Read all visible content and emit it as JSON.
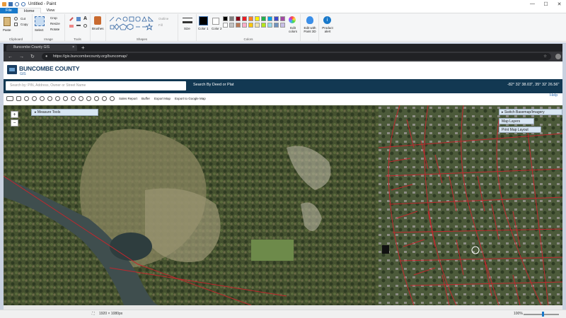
{
  "window": {
    "title": "Untitled - Paint",
    "controls": [
      "—",
      "☐",
      "✕"
    ]
  },
  "ribbon_tabs": [
    "File",
    "Home",
    "View"
  ],
  "clipboard": {
    "paste": "Paste",
    "cut": "Cut",
    "copy": "Copy",
    "label": "Clipboard"
  },
  "image": {
    "select": "Select",
    "crop": "Crop",
    "resize": "Resize",
    "rotate": "Rotate",
    "label": "Image"
  },
  "tools": {
    "label": "Tools"
  },
  "brushes": {
    "label": "Brushes"
  },
  "shapes": {
    "outline": "Outline",
    "fill": "Fill",
    "label": "Shapes"
  },
  "size": {
    "label": "Size"
  },
  "colors": {
    "color1": "Color 1",
    "color2": "Color 2",
    "edit": "Edit colors",
    "label": "Colors",
    "palette_row1": [
      "#000000",
      "#7f7f7f",
      "#880015",
      "#ed1c24",
      "#ff7f27",
      "#fff200",
      "#22b14c",
      "#00a2e8",
      "#3f48cc",
      "#a349a4"
    ],
    "palette_row2": [
      "#ffffff",
      "#c3c3c3",
      "#b97a57",
      "#ffaec9",
      "#ffc90e",
      "#efe4b0",
      "#b5e61d",
      "#99d9ea",
      "#7092be",
      "#c8bfe7"
    ]
  },
  "paint3d": {
    "label": "Edit with Paint 3D"
  },
  "alert": {
    "label": "Product alert"
  },
  "browser": {
    "tab_title": "Buncombe County GIS",
    "url": "https://gis.buncombecounty.org/buncomap/"
  },
  "gis": {
    "county": "BUNCOMBE COUNTY",
    "sub": "GIS",
    "search_placeholder": "Search by: PIN, Address, Owner or Street Name",
    "deed_link": "Search By Deed or Plat",
    "coords": "-82° 32' 38.03\", 35° 32' 26.56\"",
    "tool_links": [
      "Sales Report",
      "Buffer",
      "Export Map",
      "Export to Google Map"
    ],
    "help": "Help"
  },
  "map": {
    "measure_tools": "▸ Measure Tools",
    "switch_basemap": "▸ Switch Basemap/Imagery",
    "map_layers": "Map Layers",
    "print_layout": "Print Map Layout",
    "zoom_in": "+",
    "zoom_out": "−"
  },
  "status": {
    "dimensions": "1920 × 1080px",
    "zoom": "100%"
  }
}
